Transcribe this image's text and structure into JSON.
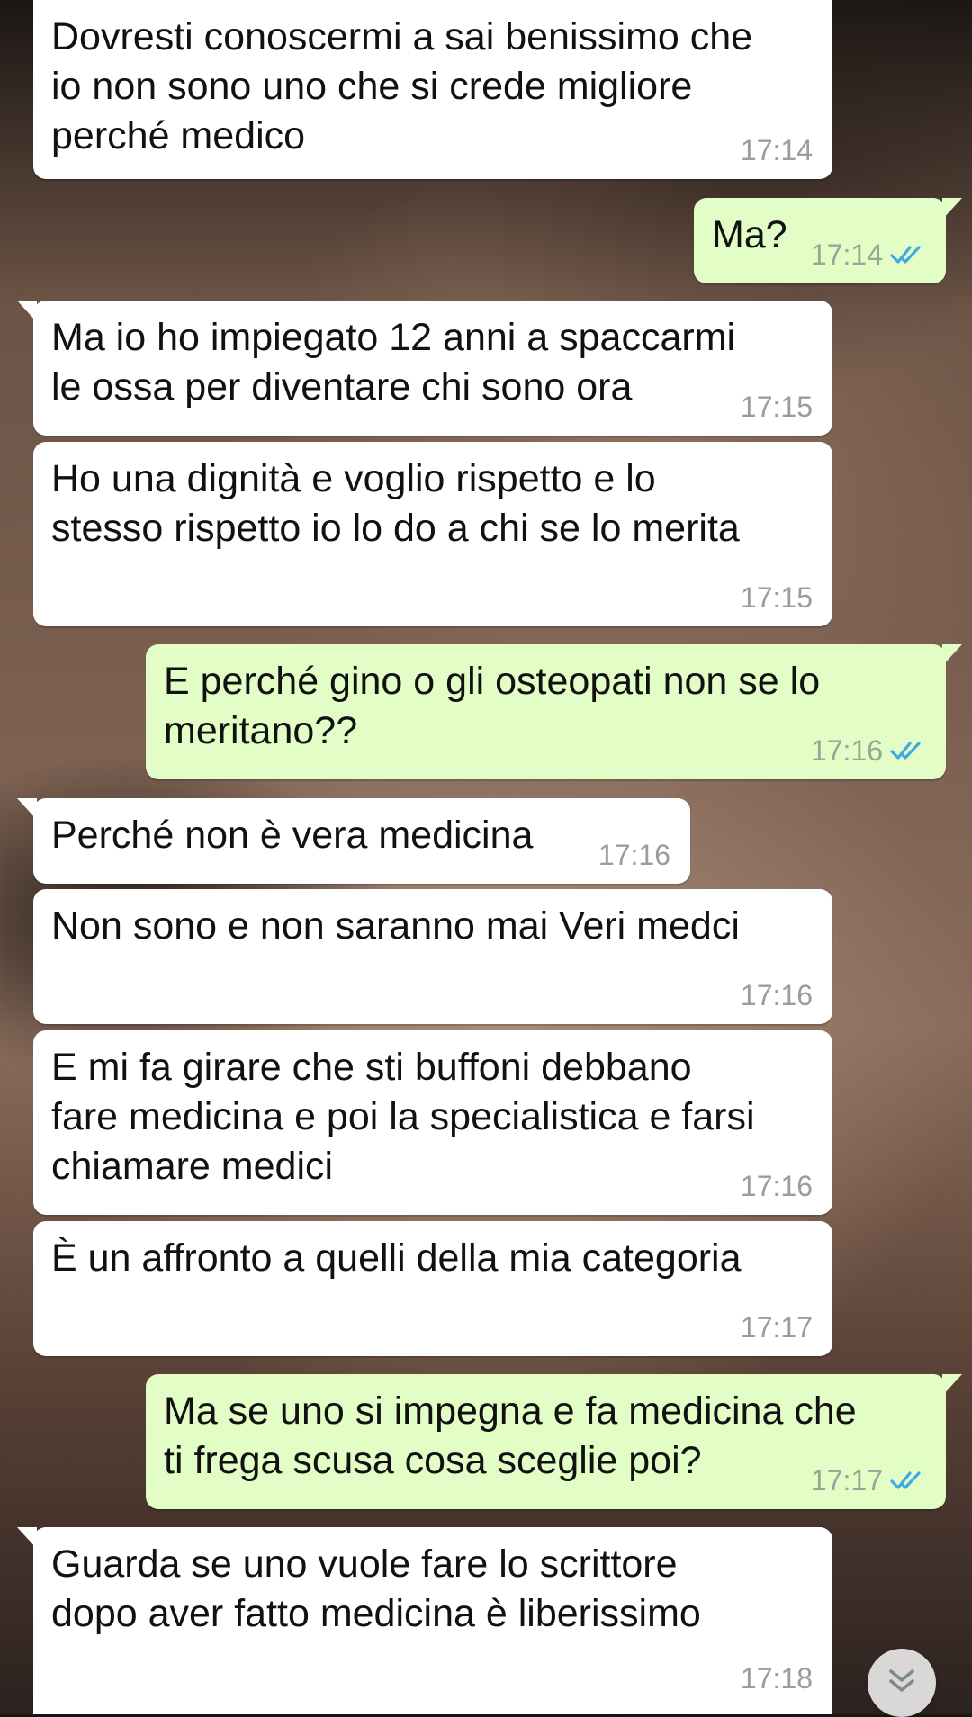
{
  "colors": {
    "incoming_bubble": "#ffffff",
    "outgoing_bubble": "#e2fdc6",
    "timestamp": "#9c9c9c",
    "read_ticks": "#3fa9e6"
  },
  "messages": [
    {
      "direction": "incoming",
      "text": "Dovresti conoscermi a sai benissimo che\nio non sono uno che si crede migliore\nperché medico",
      "time": "17:14"
    },
    {
      "direction": "outgoing",
      "text": "Ma?",
      "time": "17:14",
      "status_icon": "double-check-read-icon"
    },
    {
      "direction": "incoming",
      "text": "Ma io ho impiegato 12 anni a spaccarmi\nle ossa per diventare chi sono ora",
      "time": "17:15"
    },
    {
      "direction": "incoming",
      "text": "Ho una dignità e voglio rispetto e lo\nstesso rispetto io lo do a chi se lo merita",
      "time": "17:15"
    },
    {
      "direction": "outgoing",
      "text": "E perché gino o gli osteopati non se lo\nmeritano??",
      "time": "17:16",
      "status_icon": "double-check-read-icon"
    },
    {
      "direction": "incoming",
      "text": "Perché non è vera medicina",
      "time": "17:16"
    },
    {
      "direction": "incoming",
      "text": "Non sono e non saranno mai Veri medci",
      "time": "17:16"
    },
    {
      "direction": "incoming",
      "text": "E mi fa girare che sti buffoni debbano\nfare medicina e poi la specialistica e farsi\nchiamare medici",
      "time": "17:16"
    },
    {
      "direction": "incoming",
      "text": "È un affronto a quelli della mia categoria",
      "time": "17:17"
    },
    {
      "direction": "outgoing",
      "text": "Ma se uno si impegna e fa medicina che\nti frega scusa cosa sceglie poi?",
      "time": "17:17",
      "status_icon": "double-check-read-icon"
    },
    {
      "direction": "incoming",
      "text": "Guarda se uno vuole fare lo scrittore\ndopo aver fatto medicina è liberissimo",
      "time": "17:18"
    }
  ],
  "scroll_button": {
    "icon": "double-chevron-down-icon"
  }
}
